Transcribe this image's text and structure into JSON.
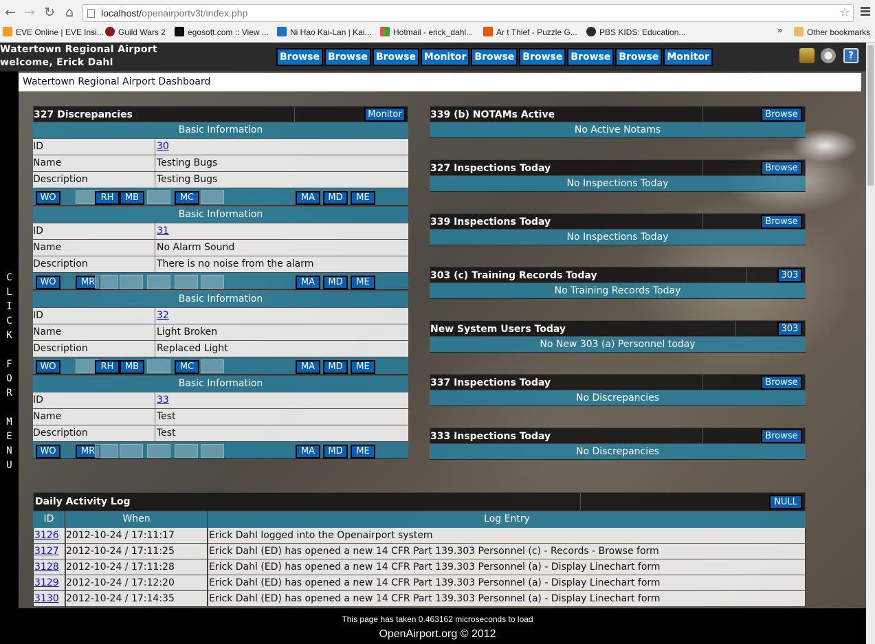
{
  "browser": {
    "url_host": "localhost/",
    "url_path": "openairportv3t/index.php",
    "bookmarks": [
      "EVE Online | EVE Insi...",
      "Guild Wars 2",
      "egosoft.com :: View ...",
      "Ni Hao Kai-Lan | Kai...",
      "Hotmail - erick_dahl...",
      "Ar t Thief - Puzzle G...",
      "PBS KIDS: Education..."
    ],
    "overflow": "»",
    "other_bookmarks": "Other bookmarks"
  },
  "site": {
    "name": "Watertown Regional Airport",
    "welcome": "welcome, Erick Dahl",
    "nav": [
      "Browse",
      "Browse",
      "Browse",
      "Monitor",
      "Browse",
      "Browse",
      "Browse",
      "Browse",
      "Monitor"
    ],
    "side_menu": [
      "C",
      "L",
      "I",
      "C",
      "K",
      "",
      "F",
      "O",
      "R",
      "",
      "M",
      "E",
      "N",
      "U"
    ],
    "dashboard_title": "Watertown Regional Airport Dashboard"
  },
  "discrepancies": {
    "title": "327 Discrepancies",
    "button": "Monitor",
    "section_label": "Basic Information",
    "labels": {
      "id": "ID",
      "name": "Name",
      "description": "Description"
    },
    "records": [
      {
        "id": "30",
        "name": "Testing Bugs",
        "description": "Testing Bugs",
        "left_buttons": [
          "WO",
          "",
          "RH",
          "MB",
          "",
          "MC",
          ""
        ],
        "right_buttons": [
          "MA",
          "MD",
          "ME"
        ]
      },
      {
        "id": "31",
        "name": "No Alarm Sound",
        "description": "There is no noise from the alarm",
        "left_buttons": [
          "WO",
          "MR",
          "",
          "",
          "",
          "",
          ""
        ],
        "right_buttons": [
          "MA",
          "MD",
          "ME"
        ]
      },
      {
        "id": "32",
        "name": "Light Broken",
        "description": "Replaced Light",
        "left_buttons": [
          "WO",
          "",
          "RH",
          "MB",
          "",
          "MC",
          ""
        ],
        "right_buttons": [
          "MA",
          "MD",
          "ME"
        ]
      },
      {
        "id": "33",
        "name": "Test",
        "description": "Test",
        "left_buttons": [
          "WO",
          "MR",
          "",
          "",
          "",
          "",
          ""
        ],
        "right_buttons": [
          "MA",
          "MD",
          "ME"
        ]
      }
    ]
  },
  "panels": [
    {
      "title": "339 (b) NOTAMs Active",
      "button": "Browse",
      "message": "No Active Notams"
    },
    {
      "title": "327 Inspections Today",
      "button": "Browse",
      "message": "No Inspections Today"
    },
    {
      "title": "339 Inspections Today",
      "button": "Browse",
      "message": "No Inspections Today"
    },
    {
      "title": "303 (c) Training Records Today",
      "button": "303",
      "message": "No Training Records Today"
    },
    {
      "title": "New System Users Today",
      "button": "303",
      "message": "No New 303 (a) Personnel today"
    },
    {
      "title": "337 Inspections Today",
      "button": "Browse",
      "message": "No Discrepancies"
    },
    {
      "title": "333 Inspections Today",
      "button": "Browse",
      "message": "No Discrepancies"
    }
  ],
  "activity_log": {
    "title": "Daily Activity Log",
    "button": "NULL",
    "columns": [
      "ID",
      "When",
      "Log Entry"
    ],
    "rows": [
      {
        "id": "3126",
        "when": "2012-10-24 / 17:11:17",
        "entry": "Erick Dahl logged into the Openairport system"
      },
      {
        "id": "3127",
        "when": "2012-10-24 / 17:11:25",
        "entry": "Erick Dahl (ED) has opened a new 14 CFR Part 139.303 Personnel (c) - Records - Browse form"
      },
      {
        "id": "3128",
        "when": "2012-10-24 / 17:11:28",
        "entry": "Erick Dahl (ED) has opened a new 14 CFR Part 139.303 Personnel (a) - Display Linechart form"
      },
      {
        "id": "3129",
        "when": "2012-10-24 / 17:12:20",
        "entry": "Erick Dahl (ED) has opened a new 14 CFR Part 139.303 Personnel (a) - Display Linechart form"
      },
      {
        "id": "3130",
        "when": "2012-10-24 / 17:14:35",
        "entry": "Erick Dahl (ED) has opened a new 14 CFR Part 139.303 Personnel (a) - Display Linechart form"
      }
    ]
  },
  "footer": {
    "load_time": "This page has taken 0.463162 microseconds to load",
    "copyright": "OpenAirport.org © 2012"
  },
  "colors": {
    "button_blue": "#0b5fb0",
    "bar_teal": "#2680a0",
    "nav_blue": "#0b6fc3"
  }
}
